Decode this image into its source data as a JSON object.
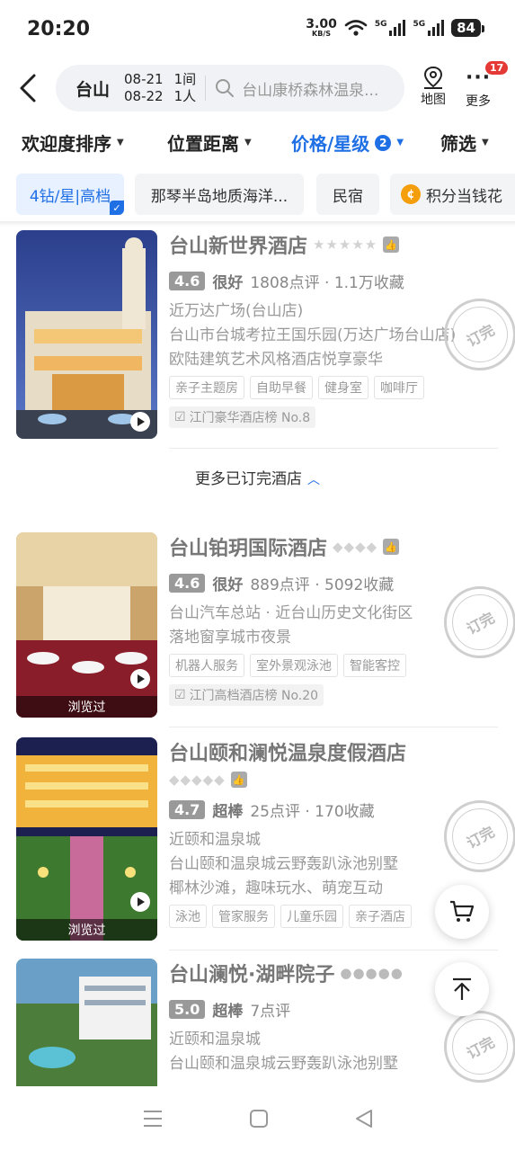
{
  "status": {
    "time": "20:20",
    "net_speed": "3.00",
    "net_unit": "KB/S",
    "sig1": "5G",
    "sig2": "5G",
    "battery": "84"
  },
  "header": {
    "city": "台山",
    "checkin": "08-21",
    "checkout": "08-22",
    "rooms": "1间",
    "guests": "1人",
    "search_placeholder": "台山康桥森林温泉...",
    "map_label": "地图",
    "more_label": "更多",
    "more_badge": "17"
  },
  "sort": {
    "popularity": "欢迎度排序",
    "distance": "位置距离",
    "price_star": "价格/星级",
    "price_star_count": "2",
    "filter": "筛选"
  },
  "chips": [
    "4钻/星|高档",
    "那琴半岛地质海洋...",
    "民宿",
    "积分当钱花"
  ],
  "more_booked": "更多已订完酒店",
  "hotels": [
    {
      "name": "台山新世界酒店",
      "stars": "★★★★★",
      "score": "4.6",
      "level": "很好",
      "reviews": "1808点评 · 1.1万收藏",
      "line1": "近万达广场(台山店)",
      "line2": "台山市台城考拉王国乐园(万达广场台山店)",
      "line3": "欧陆建筑艺术风格酒店悦享豪华",
      "tags": [
        "亲子主题房",
        "自助早餐",
        "健身室",
        "咖啡厅"
      ],
      "rank": "江门豪华酒店榜 No.8",
      "stamp": "订完"
    },
    {
      "name": "台山铂玥国际酒店",
      "stars": "◆◆◆◆",
      "score": "4.6",
      "level": "很好",
      "reviews": "889点评 · 5092收藏",
      "line1": "台山汽车总站 · 近台山历史文化街区",
      "line2": "落地窗享城市夜景",
      "tags": [
        "机器人服务",
        "室外景观泳池",
        "智能客控"
      ],
      "rank": "江门高档酒店榜 No.20",
      "viewed": "浏览过",
      "stamp": "订完"
    },
    {
      "name": "台山颐和澜悦温泉度假酒店",
      "stars": "◆◆◆◆◆",
      "score": "4.7",
      "level": "超棒",
      "reviews": "25点评 · 170收藏",
      "line1": "近颐和温泉城",
      "line2": "台山颐和温泉城云野轰趴泳池别墅",
      "line3": "椰林沙滩，趣味玩水、萌宠互动",
      "tags": [
        "泳池",
        "管家服务",
        "儿童乐园",
        "亲子酒店"
      ],
      "viewed": "浏览过",
      "stamp": "订完"
    },
    {
      "name": "台山澜悦·湖畔院子",
      "stars": "●●●●●",
      "score": "5.0",
      "level": "超棒",
      "reviews": "7点评",
      "line1": "近颐和温泉城",
      "line2": "台山颐和温泉城云野轰趴泳池别墅",
      "stamp": "订完"
    }
  ],
  "colors": {
    "accent": "#1f6fe5",
    "badge": "#e53935"
  }
}
